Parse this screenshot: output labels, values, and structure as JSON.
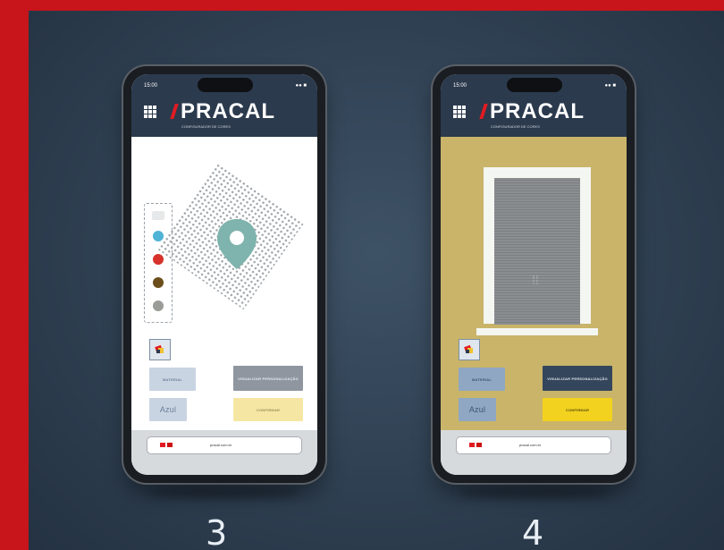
{
  "app": {
    "logo_text": "PRACAL",
    "logo_tagline": "CONFIGURADOR DE CORES"
  },
  "phones": [
    {
      "status_time": "15:00",
      "status_icons": "●● ■",
      "screen_bg": "#ffffff",
      "swatches": [
        "#4fb3d6",
        "#d6322b",
        "#6b4e1a",
        "#9a9c98"
      ],
      "buttons": {
        "material": "MATERIAL",
        "preview": "VISUALIZAR PERSONALIZAÇÃO",
        "tone": "Azul",
        "confirm": "CONFIRMAR"
      },
      "url": "pracal.com.br",
      "step_number": "3"
    },
    {
      "status_time": "15:00",
      "status_icons": "●● ■",
      "screen_bg": "#c9b46a",
      "buttons": {
        "material": "MATERIAL",
        "preview": "VISUALIZAR PERSONALIZAÇÃO",
        "tone": "Azul",
        "confirm": "CONFIRMAR"
      },
      "url": "pracal.com.br",
      "step_number": "4"
    }
  ],
  "colors": {
    "brand_red": "#e21b22",
    "header_navy": "#2b3a4d",
    "pin_teal": "#7fb3ad",
    "wall_ochre": "#c9b46a"
  },
  "icons": [
    "menu-grid-icon",
    "location-pin-icon",
    "paint-bucket-icon",
    "window-handle-icon",
    "flag-icon"
  ]
}
